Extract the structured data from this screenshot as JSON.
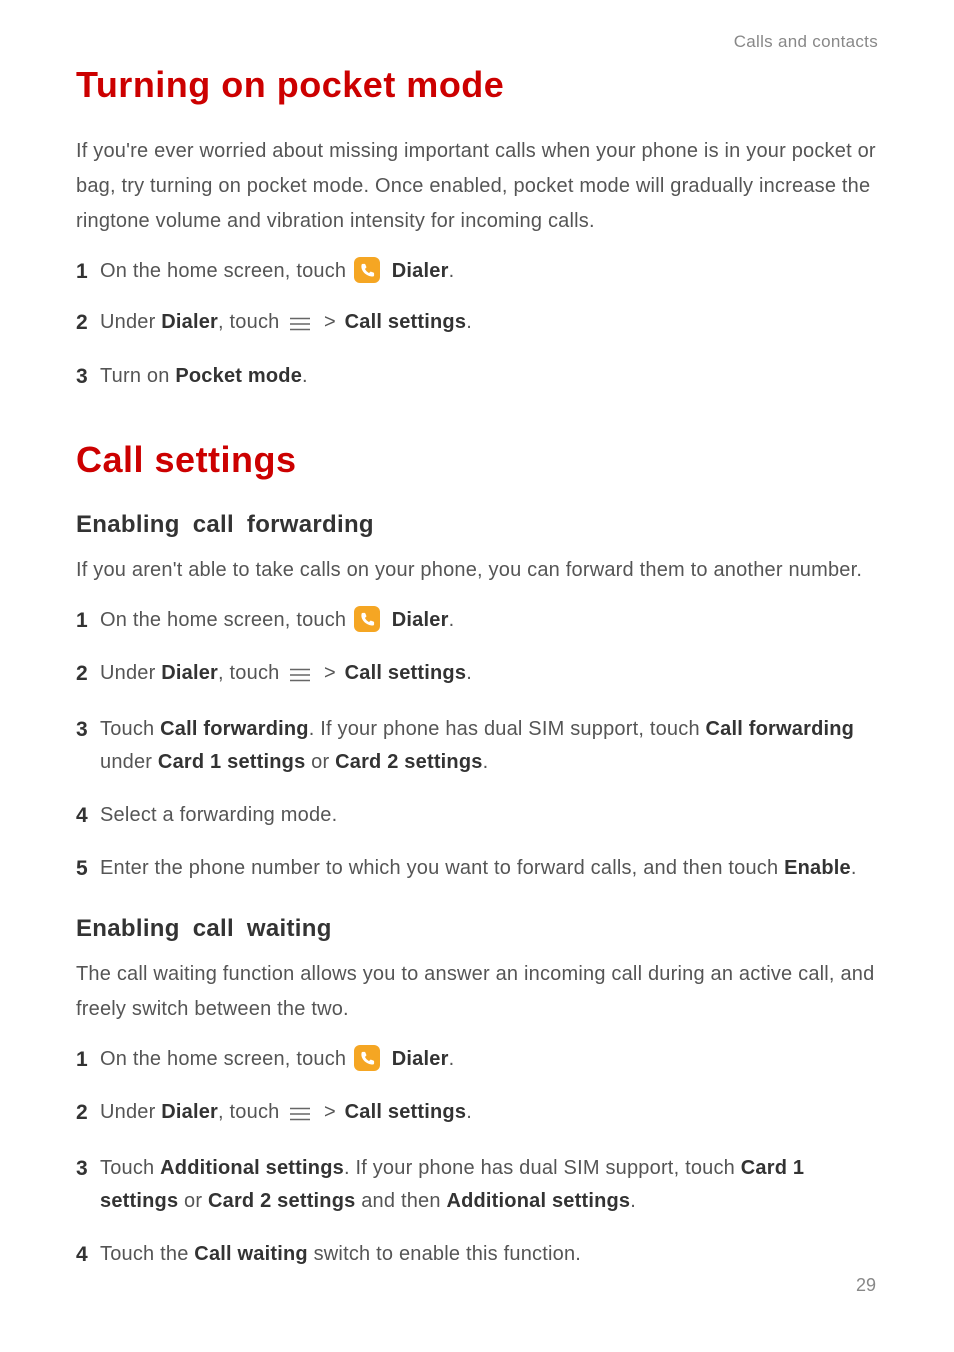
{
  "breadcrumb": "Calls and contacts",
  "page_number": "29",
  "section1": {
    "title": "Turning on pocket mode",
    "intro": "If you're ever worried about missing important calls when your phone is in your pocket or bag, try turning on pocket mode. Once enabled, pocket mode will gradually increase the ringtone volume and vibration intensity for incoming calls.",
    "steps": {
      "s1_pre": "On the home screen, touch ",
      "s1_bold": "Dialer",
      "s2_pre": "Under ",
      "s2_b1": "Dialer",
      "s2_mid": ", touch ",
      "s2_b2": "Call settings",
      "s3_pre": "Turn on ",
      "s3_bold": "Pocket mode"
    }
  },
  "section2": {
    "title": "Call settings",
    "sub1": {
      "heading": "Enabling  call  forwarding",
      "intro": "If you aren't able to take calls on your phone, you can forward them to another number.",
      "s1_pre": "On the home screen, touch ",
      "s1_bold": "Dialer",
      "s2_pre": "Under ",
      "s2_b1": "Dialer",
      "s2_mid": ", touch ",
      "s2_b2": "Call settings",
      "s3_pre": "Touch ",
      "s3_b1": "Call forwarding",
      "s3_mid1": ". If your phone has dual SIM support, touch ",
      "s3_b2": "Call forwarding",
      "s3_mid2": " under ",
      "s3_b3": "Card 1 settings",
      "s3_or": " or ",
      "s3_b4": "Card 2 settings",
      "s4": "Select a forwarding mode.",
      "s5_pre": "Enter the phone number to which you want to forward calls, and then touch ",
      "s5_bold": "Enable"
    },
    "sub2": {
      "heading": "Enabling  call  waiting",
      "intro": "The call waiting function allows you to answer an incoming call during an active call, and freely switch between the two.",
      "s1_pre": "On the home screen, touch ",
      "s1_bold": "Dialer",
      "s2_pre": "Under ",
      "s2_b1": "Dialer",
      "s2_mid": ", touch ",
      "s2_b2": "Call settings",
      "s3_pre": "Touch ",
      "s3_b1": "Additional settings",
      "s3_mid1": ". If your phone has dual SIM support, touch ",
      "s3_b2": "Card 1 settings",
      "s3_or": " or ",
      "s3_b3": "Card 2 settings",
      "s3_mid2": " and then ",
      "s3_b4": "Additional settings",
      "s4_pre": "Touch the ",
      "s4_bold": "Call waiting",
      "s4_post": " switch to enable this function."
    }
  },
  "gt": ">"
}
